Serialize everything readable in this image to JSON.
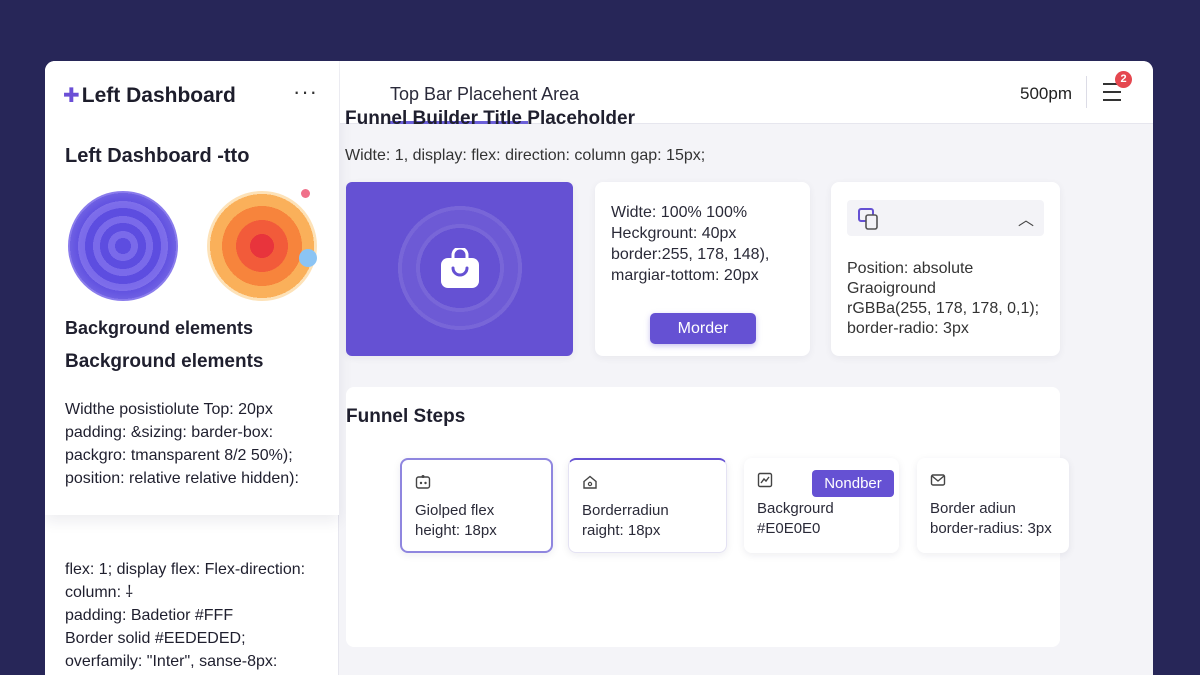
{
  "sidebar": {
    "brand": "Left Dashboard",
    "more": "···",
    "title": "Left Dashboard -tto",
    "bg_label_1": "Background elements",
    "bg_label_2": "Background elements",
    "desc_lines": [
      "Widthe posistiolute Top: 20px",
      "padding: &sizing: barder-box:",
      "packgro: tmansparent 8/2 50%);",
      "position: relative relative hidden):"
    ],
    "desc2_lines": [
      "flex: 1; display flex: Flex-direction:",
      "column: ⸸",
      "padding: Badetior #FFF",
      "Border solid #EEDEDED;",
      "overfamily: \"Inter\", sanse-8px:"
    ]
  },
  "topbar": {
    "title": "Top Bar Placehent Area",
    "time": "500pm",
    "badge_count": "2"
  },
  "main": {
    "title": "Funnel Builder Title Placeholder",
    "subtitle": "Widte: 1, display: flex: direction: column gap: 15px;",
    "card2_lines": [
      "Widte: 100% 100%",
      "Heckgrount: 40px",
      "border:255, 178, 148),",
      "margiar-tottom: 20px"
    ],
    "card2_button": "Morder",
    "card3_lines": [
      "Position: absolute",
      "Graoiground",
      "rGBBa(255, 178, 178, 0,1);",
      "border-radio: 3px"
    ],
    "steps_title": "Funnel Steps",
    "steps": [
      {
        "line1": "Giolped flex",
        "line2": "height: 18px"
      },
      {
        "line1": "Borderradiun",
        "line2": "raight: 18px"
      },
      {
        "line1": "Backgrourd",
        "line2": "#E0E0E0",
        "pill": "Nondber"
      },
      {
        "line1": "Border adiun",
        "line2": "border-radius: 3px"
      }
    ]
  },
  "colors": {
    "page_bg": "#272658",
    "accent": "#6551d3",
    "badge": "#e5474f"
  },
  "icons": [
    "plus-icon",
    "more-icon",
    "menu-icon",
    "bag-icon",
    "devices-icon",
    "chevron-up-icon",
    "step-icon-image",
    "step-icon-home",
    "step-icon-chart",
    "step-icon-mail"
  ]
}
